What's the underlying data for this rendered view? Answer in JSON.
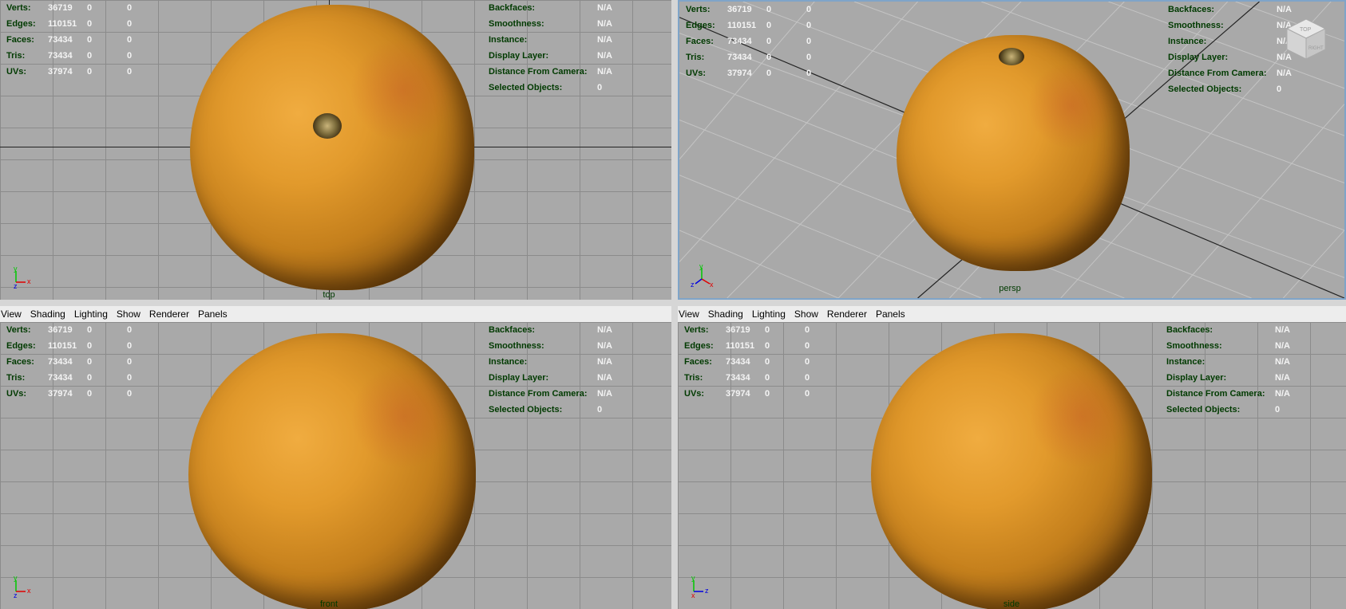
{
  "menu": [
    "View",
    "Shading",
    "Lighting",
    "Show",
    "Renderer",
    "Panels"
  ],
  "hud_left": {
    "rows": [
      {
        "label": "Verts:",
        "a": "36719",
        "b": "0",
        "c": "0"
      },
      {
        "label": "Edges:",
        "a": "110151",
        "b": "0",
        "c": "0"
      },
      {
        "label": "Faces:",
        "a": "73434",
        "b": "0",
        "c": "0"
      },
      {
        "label": "Tris:",
        "a": "73434",
        "b": "0",
        "c": "0"
      },
      {
        "label": "UVs:",
        "a": "37974",
        "b": "0",
        "c": "0"
      }
    ]
  },
  "hud_right": {
    "rows": [
      {
        "label": "Backfaces:",
        "value": "N/A"
      },
      {
        "label": "Smoothness:",
        "value": "N/A"
      },
      {
        "label": "Instance:",
        "value": "N/A"
      },
      {
        "label": "Display Layer:",
        "value": "N/A"
      },
      {
        "label": "Distance From Camera:",
        "value": "N/A"
      },
      {
        "label": "Selected Objects:",
        "value": "0"
      }
    ]
  },
  "viewports": {
    "top": {
      "camera": "top",
      "axis1": "y",
      "axis2": "x",
      "axis3": "z"
    },
    "persp": {
      "camera": "persp",
      "axis1": "y",
      "axis2": "x",
      "axis3": "z"
    },
    "front": {
      "camera": "front",
      "axis1": "y",
      "axis2": "x",
      "axis3": "z"
    },
    "side": {
      "camera": "side",
      "axis1": "y",
      "axis2": "x",
      "axis3": "z"
    }
  },
  "viewcube": {
    "face_top": "TOP",
    "face_right": "RIGHT"
  },
  "colors": {
    "viewport_bg": "#a9a9a9",
    "grid": "#8b8b8b",
    "hud_label": "#003a00",
    "hud_value": "#f4f4f4",
    "axis_y": "#00c800",
    "axis_x": "#e00000",
    "axis_z": "#0000e0"
  }
}
